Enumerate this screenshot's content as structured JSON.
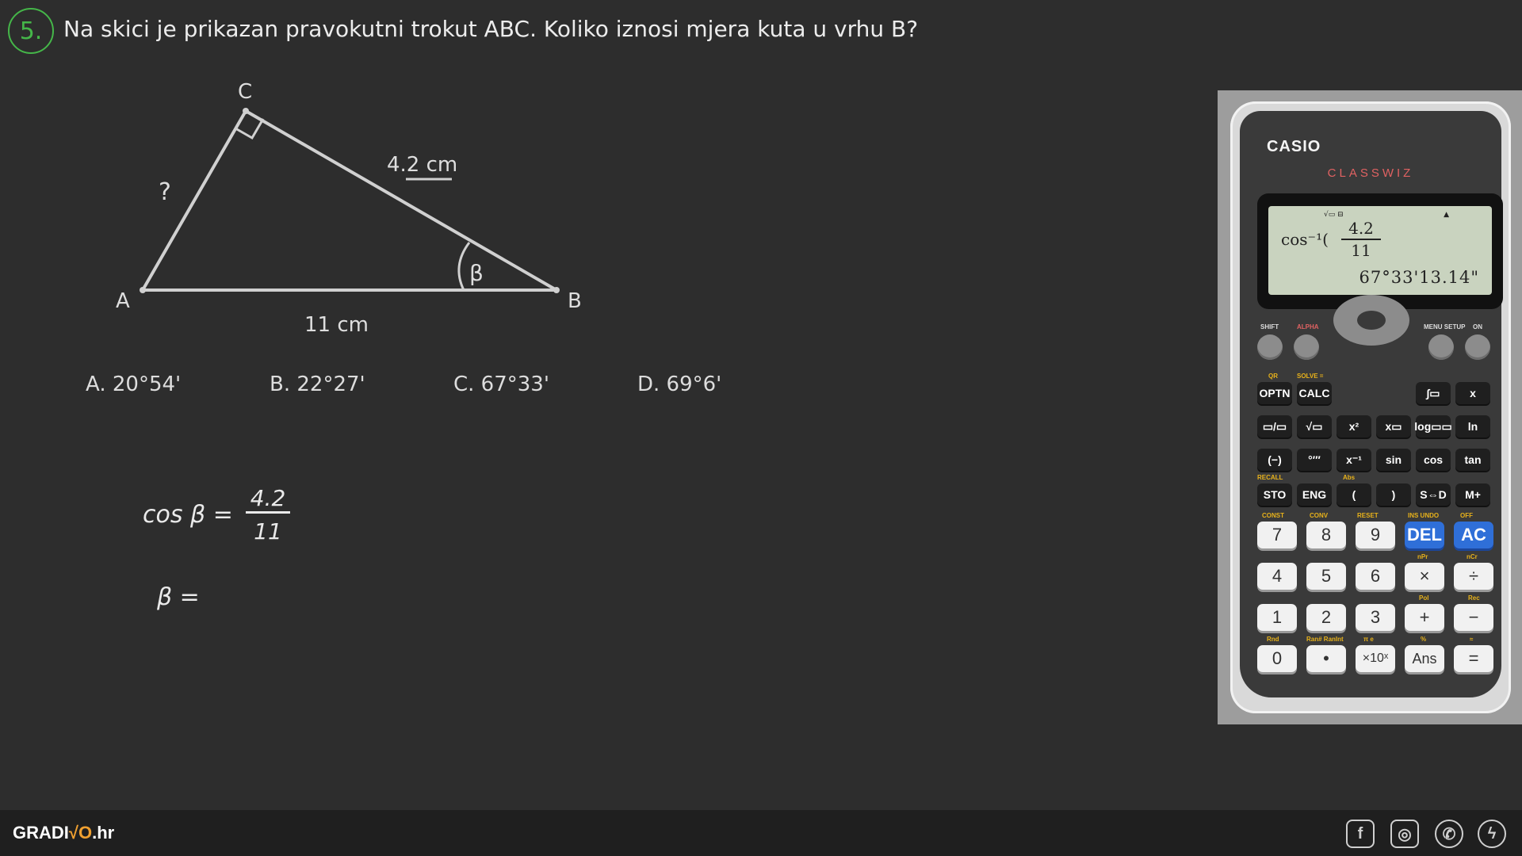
{
  "problem": {
    "number": "5.",
    "text": "Na skici je prikazan pravokutni trokut ABC. Koliko iznosi mjera kuta u vrhu B?"
  },
  "sketch": {
    "vertex_a": "A",
    "vertex_b": "B",
    "vertex_c": "C",
    "side_ac": "?",
    "side_bc": "4.2 cm",
    "side_ab": "11 cm",
    "angle": "β"
  },
  "answers": [
    {
      "label": "A. 20°54'"
    },
    {
      "label": "B. 22°27'"
    },
    {
      "label": "C. 67°33'"
    },
    {
      "label": "D. 69°6'"
    }
  ],
  "work": {
    "lhs": "cos β =",
    "numerator": "4.2",
    "denominator": "11",
    "beta_line": "β ="
  },
  "calculator": {
    "brand": "CASIO",
    "model": "CLASSWIZ",
    "display": {
      "function": "cos⁻¹(",
      "numerator": "4.2",
      "denominator": "11",
      "result": "67°33'13.14\""
    },
    "top_labels": {
      "shift": "SHIFT",
      "alpha": "ALPHA",
      "menu": "MENU SETUP",
      "on": "ON"
    },
    "func_rows": [
      [
        "OPTN",
        "CALC",
        "∫▭",
        "x"
      ],
      [
        "▭/▭",
        "√▭",
        "x²",
        "x▭",
        "log▭▭",
        "ln"
      ],
      [
        "(−)",
        "°′″",
        "x⁻¹",
        "sin",
        "cos",
        "tan"
      ],
      [
        "STO",
        "ENG",
        "(",
        ")",
        "S⇔D",
        "M+"
      ]
    ],
    "func_row0_left": [
      "OPTN",
      "CALC"
    ],
    "num_rows": [
      [
        "7",
        "8",
        "9",
        "DEL",
        "AC"
      ],
      [
        "4",
        "5",
        "6",
        "×",
        "÷"
      ],
      [
        "1",
        "2",
        "3",
        "+",
        "−"
      ],
      [
        "0",
        "•",
        "×10ˣ",
        "Ans",
        "="
      ]
    ],
    "secondary": {
      "row1": [
        "CONST",
        "CONV",
        "RESET",
        "INS UNDO",
        "OFF"
      ],
      "row2": [
        "",
        "",
        "",
        "nPr",
        "nCr"
      ],
      "row3": [
        "",
        "",
        "",
        "Pol",
        "Rec"
      ],
      "row4": [
        "Rnd",
        "Ran# RanInt",
        "π  e",
        "%",
        "≈"
      ],
      "f0": [
        "QR",
        "SOLVE ="
      ],
      "f3": [
        "RECALL",
        "Abs"
      ]
    }
  },
  "footer": {
    "logo_main": "GRADI",
    "logo_accent": "√O",
    "logo_end": ".hr",
    "icons": [
      "facebook-icon",
      "instagram-icon",
      "whatsapp-icon",
      "messenger-icon"
    ]
  },
  "colors": {
    "background": "#2d2d2d",
    "accent_green": "#45b649",
    "calc_blue": "#2f6fd8",
    "model_red": "#e06262"
  }
}
